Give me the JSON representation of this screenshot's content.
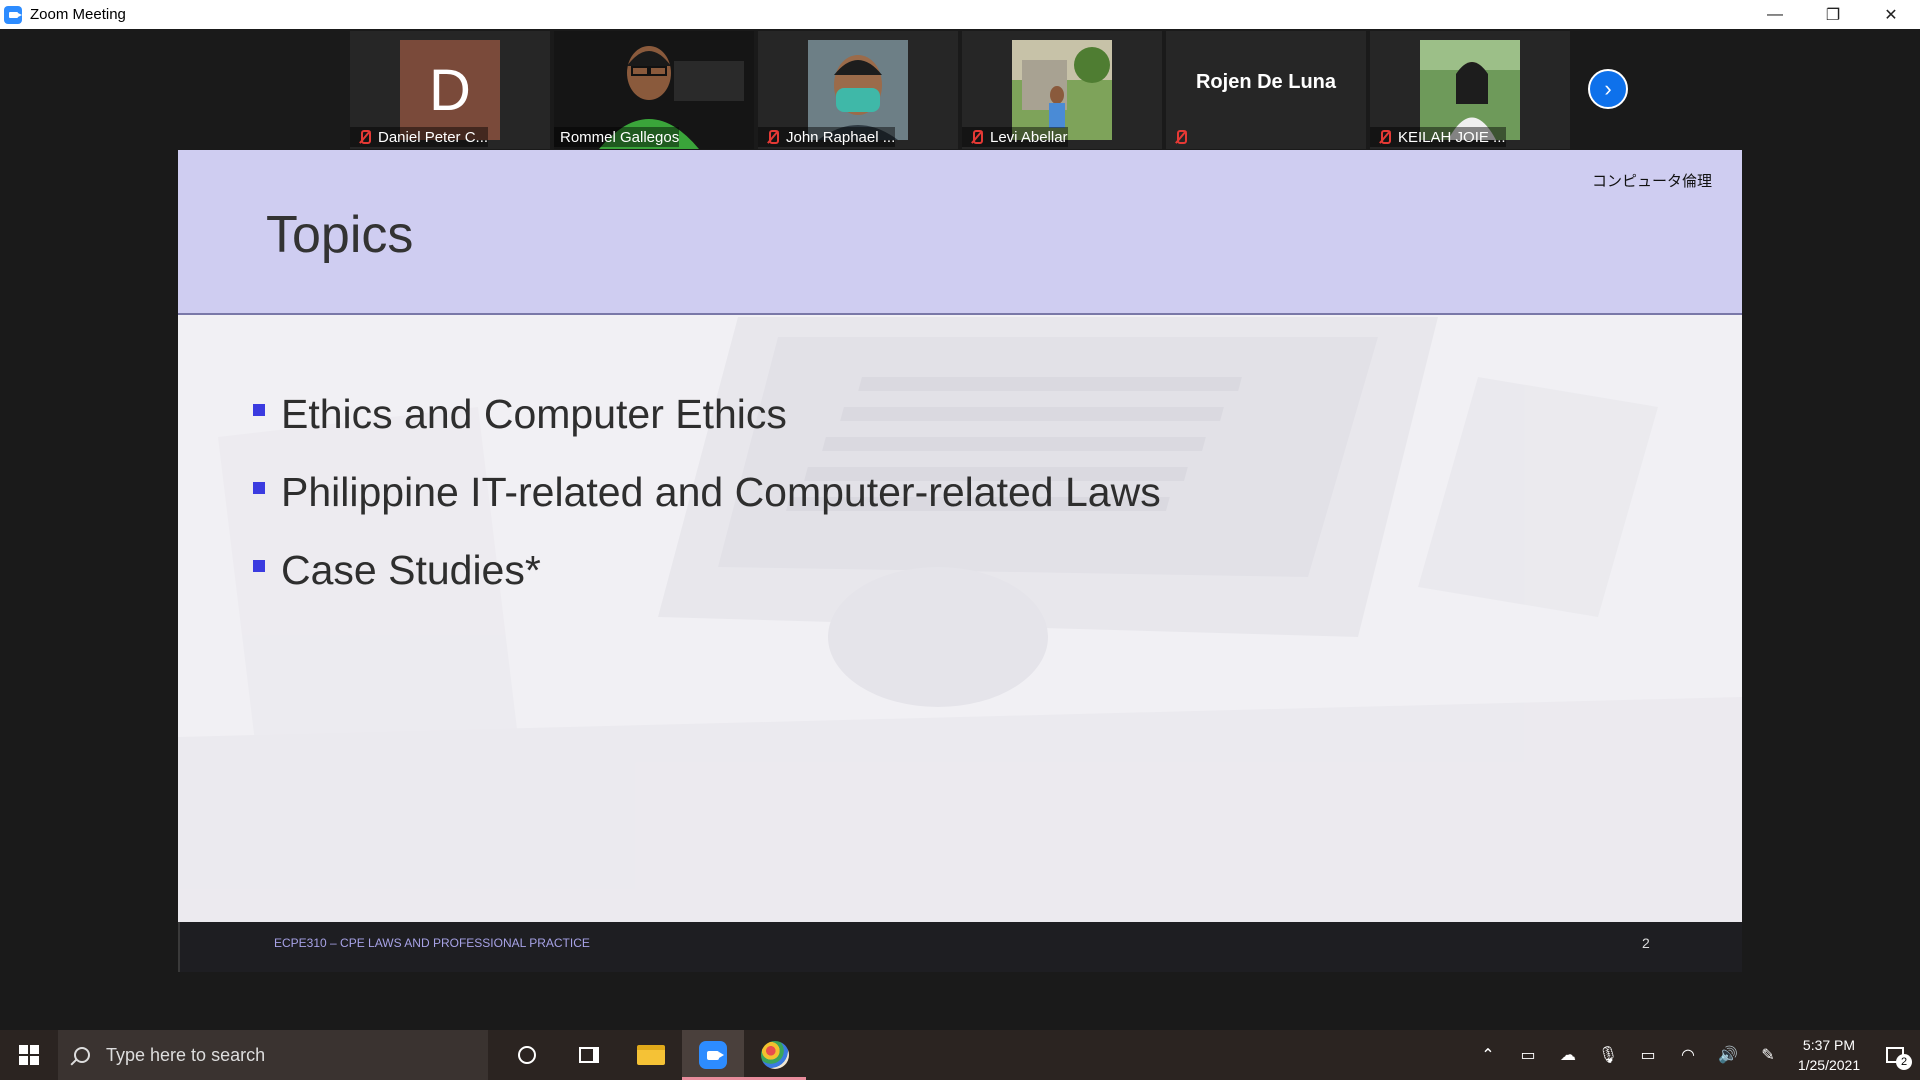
{
  "window": {
    "title": "Zoom Meeting",
    "controls": [
      "—",
      "❐",
      "✕"
    ]
  },
  "participants": [
    {
      "name": "Daniel Peter C...",
      "avatar_letter": "D",
      "muted": true,
      "video": false
    },
    {
      "name": "Rommel Gallegos",
      "muted": false,
      "video": true,
      "active_speaker": true
    },
    {
      "name": "John Raphael ...",
      "muted": true,
      "video": true
    },
    {
      "name": "Levi Abellar",
      "muted": true,
      "video": true
    },
    {
      "name": "Rojen De Luna",
      "muted": true,
      "video": false
    },
    {
      "name": "KEILAH JOIE ...",
      "muted": true,
      "video": true
    }
  ],
  "slide": {
    "tag": "コンピュータ倫理",
    "title": "Topics",
    "bullets": [
      "Ethics and Computer Ethics",
      "Philippine IT-related and Computer-related Laws",
      "Case Studies*"
    ],
    "footer": "ECPE310 – CPE LAWS AND PROFESSIONAL PRACTICE",
    "page": "2"
  },
  "taskbar": {
    "search_placeholder": "Type here to search",
    "time": "5:37 PM",
    "date": "1/25/2021",
    "notifications": "2"
  },
  "colors": {
    "accent": "#2d8cff",
    "slide_header": "#cfcdf1",
    "bullet": "#3b3be0",
    "active_speaker": "#9acd32",
    "mute": "#e53935"
  }
}
